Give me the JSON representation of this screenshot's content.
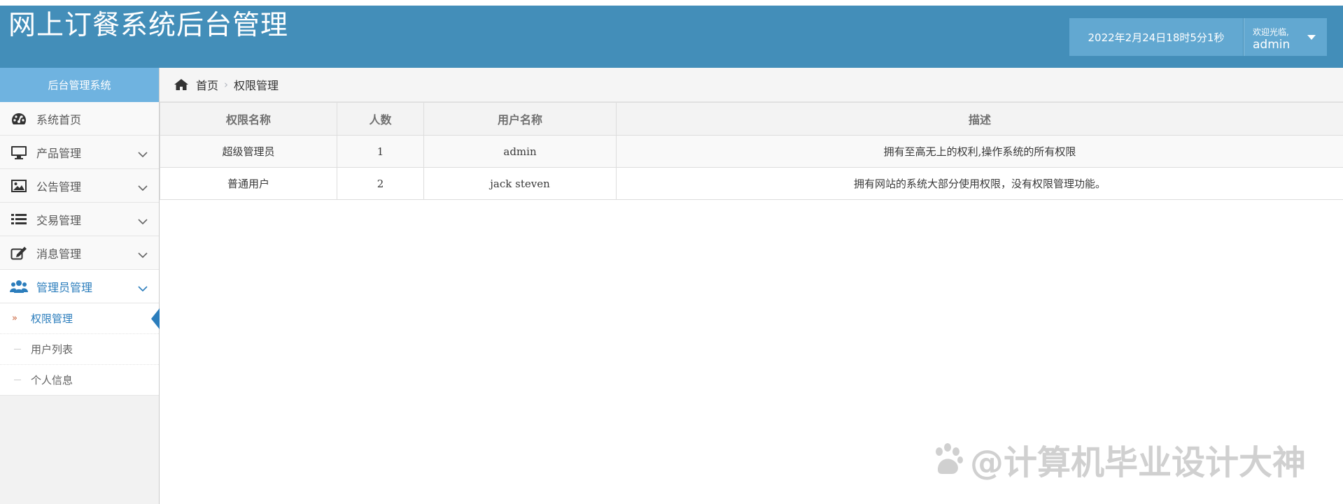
{
  "header": {
    "app_title": "网上订餐系统后台管理",
    "datetime": "2022年2月24日18时5分1秒",
    "welcome": "欢迎光临,",
    "username": "admin"
  },
  "sidebar": {
    "title": "后台管理系统",
    "items": [
      {
        "label": "系统首页",
        "icon": "dashboard-icon"
      },
      {
        "label": "产品管理",
        "icon": "monitor-icon"
      },
      {
        "label": "公告管理",
        "icon": "picture-icon"
      },
      {
        "label": "交易管理",
        "icon": "list-icon"
      },
      {
        "label": "消息管理",
        "icon": "edit-icon"
      },
      {
        "label": "管理员管理",
        "icon": "users-icon"
      }
    ],
    "subitems": [
      {
        "label": "权限管理"
      },
      {
        "label": "用户列表"
      },
      {
        "label": "个人信息"
      }
    ]
  },
  "breadcrumb": {
    "home": "首页",
    "current": "权限管理"
  },
  "table": {
    "headers": [
      "权限名称",
      "人数",
      "用户名称",
      "描述"
    ],
    "rows": [
      [
        "超级管理员",
        "1",
        "admin",
        "拥有至高无上的权利,操作系统的所有权限"
      ],
      [
        "普通用户",
        "2",
        "jack steven",
        "拥有网站的系统大部分使用权限，没有权限管理功能。"
      ]
    ]
  },
  "watermark": "@计算机毕业设计大神",
  "colors": {
    "header_bg": "#438eb9",
    "header_box_bg": "#62a8d1",
    "sidebar_header_bg": "#6fb3e0",
    "active_text": "#2b7dbc"
  }
}
